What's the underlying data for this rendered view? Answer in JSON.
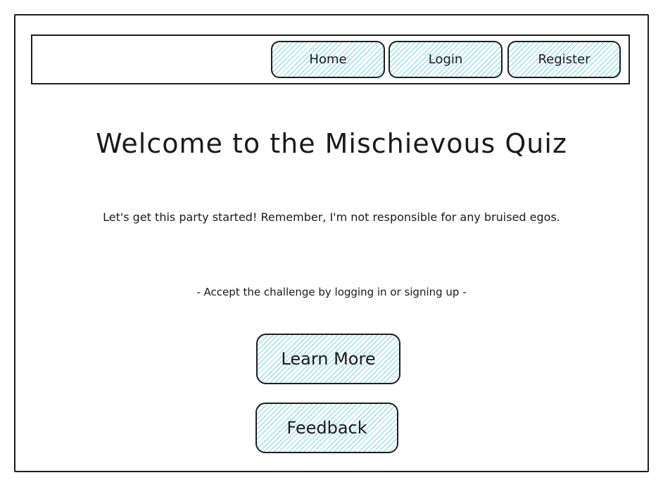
{
  "nav": {
    "home_label": "Home",
    "login_label": "Login",
    "register_label": "Register"
  },
  "main": {
    "title": "Welcome to the Mischievous Quiz",
    "tagline": "Let's get this party started! Remember, I'm not responsible for any bruised egos.",
    "cta_hint": "- Accept the challenge by logging in or signing up -",
    "learn_more_label": "Learn More",
    "feedback_label": "Feedback"
  },
  "colors": {
    "stroke": "#1e1e1e",
    "hatch": "#10bec8",
    "background": "#ffffff"
  }
}
